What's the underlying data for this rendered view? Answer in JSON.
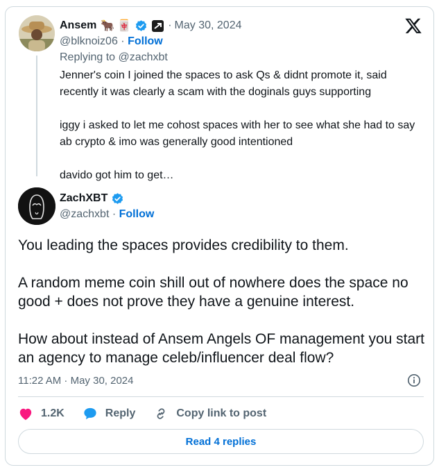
{
  "colors": {
    "accent": "#006fd6",
    "muted": "#536471",
    "heart": "#f91880",
    "verified": "#1d9bf0"
  },
  "parent_post": {
    "author_name": "Ansem",
    "name_emojis": [
      "🐂",
      "🀄"
    ],
    "icons": [
      "verified-badge-icon",
      "sponsor-badge-icon"
    ],
    "separator": "·",
    "date": "May 30, 2024",
    "handle": "@blknoiz06",
    "dot": "·",
    "follow_label": "Follow",
    "replying_to": "Replying to @zachxbt",
    "paragraphs": [
      "Jenner's coin I joined the spaces to ask Qs & didnt promote it, said recently it was clearly a scam with the doginals guys supporting",
      "iggy i asked to let me cohost spaces with her to see what she had to say ab crypto & imo was generally good intentioned",
      "davido got him to get…"
    ]
  },
  "main_post": {
    "author_name": "ZachXBT",
    "handle": "@zachxbt",
    "dot": "·",
    "follow_label": "Follow",
    "paragraphs": [
      "You leading the spaces provides credibility to them.",
      "A random meme coin shill out of nowhere does the space no good + does not prove they have a genuine interest.",
      "How about instead of Ansem Angels OF management you start an agency to manage celeb/influencer deal flow?"
    ],
    "timestamp": "11:22 AM · May 30, 2024"
  },
  "actions": {
    "likes": "1.2K",
    "reply_label": "Reply",
    "copy_label": "Copy link to post"
  },
  "read_replies_label": "Read 4 replies"
}
